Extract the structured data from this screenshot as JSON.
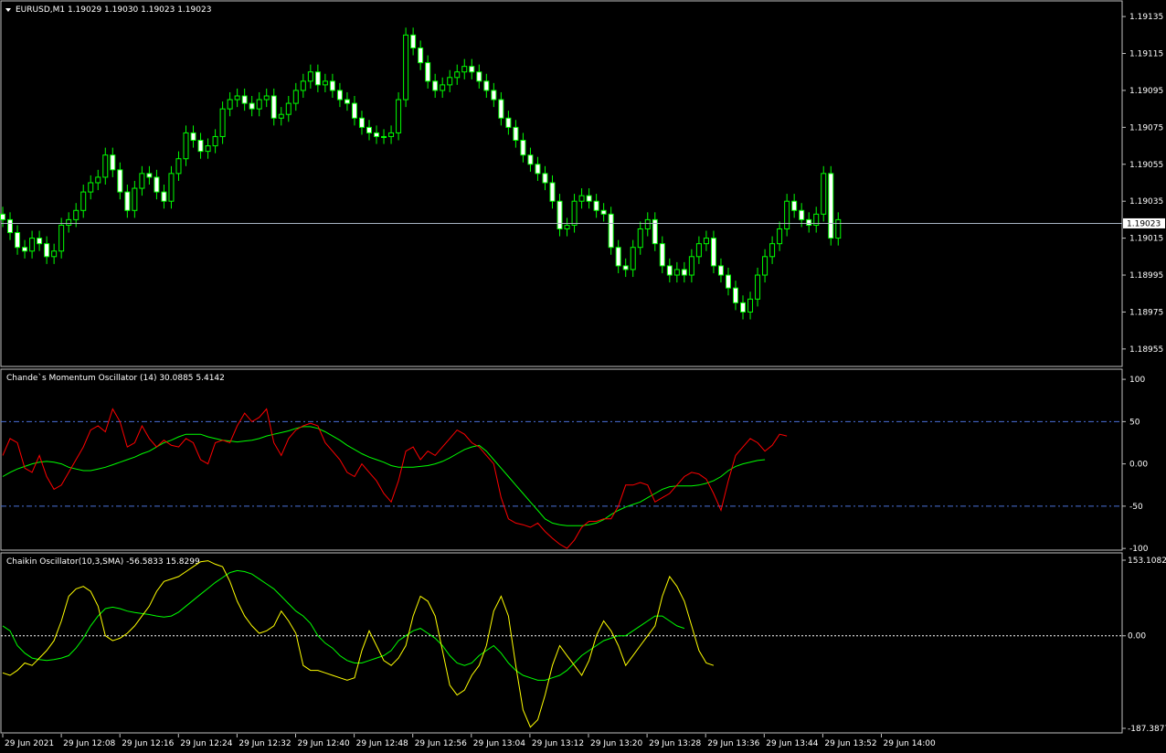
{
  "main": {
    "header": "EURUSD,M1  1.19029 1.19030 1.19023 1.19023",
    "y_ticks": [
      "1.19135",
      "1.19115",
      "1.19095",
      "1.19075",
      "1.19055",
      "1.19035",
      "1.19015",
      "1.18995",
      "1.18975",
      "1.18955"
    ],
    "y_tick_values": [
      1.19135,
      1.19115,
      1.19095,
      1.19075,
      1.19055,
      1.19035,
      1.19015,
      1.18995,
      1.18975,
      1.18955
    ],
    "price_range": [
      1.18948,
      1.1914
    ],
    "current_price": "1.19023",
    "current_price_value": 1.19023,
    "colors": {
      "candle": "#00ff00",
      "price_line": "#a8b4c4",
      "price_label_bg": "#ffffff",
      "price_label_fg": "#000000"
    },
    "chart_data": {
      "type": "candlestick",
      "bars_per_minute": 1,
      "close": [
        1.19025,
        1.19018,
        1.1901,
        1.19008,
        1.19015,
        1.19012,
        1.19005,
        1.19008,
        1.19022,
        1.19025,
        1.1903,
        1.1904,
        1.19045,
        1.19048,
        1.1906,
        1.19052,
        1.1904,
        1.1903,
        1.19042,
        1.1905,
        1.19048,
        1.1904,
        1.19035,
        1.1905,
        1.19058,
        1.19072,
        1.19068,
        1.19062,
        1.19065,
        1.1907,
        1.19085,
        1.1909,
        1.19092,
        1.19088,
        1.19085,
        1.1909,
        1.19092,
        1.1908,
        1.19082,
        1.19088,
        1.19095,
        1.191,
        1.19105,
        1.19098,
        1.191,
        1.19095,
        1.1909,
        1.19088,
        1.1908,
        1.19075,
        1.19072,
        1.1907,
        1.1907,
        1.19072,
        1.1909,
        1.19125,
        1.19118,
        1.1911,
        1.191,
        1.19095,
        1.19098,
        1.19102,
        1.19105,
        1.19108,
        1.19105,
        1.191,
        1.19095,
        1.1909,
        1.1908,
        1.19075,
        1.19068,
        1.1906,
        1.19055,
        1.1905,
        1.19045,
        1.19035,
        1.1902,
        1.19022,
        1.19035,
        1.19038,
        1.19035,
        1.1903,
        1.19028,
        1.1901,
        1.19,
        1.18998,
        1.1901,
        1.1902,
        1.19025,
        1.19012,
        1.19,
        1.18995,
        1.18998,
        1.18995,
        1.19005,
        1.19012,
        1.19015,
        1.19,
        1.18995,
        1.18988,
        1.1898,
        1.18975,
        1.18982,
        1.18995,
        1.19005,
        1.19012,
        1.1902,
        1.19035,
        1.1903,
        1.19025,
        1.19022,
        1.19028,
        1.1905,
        1.19015,
        1.19025
      ],
      "open": [
        1.19028,
        1.19025,
        1.19018,
        1.1901,
        1.19008,
        1.19015,
        1.19012,
        1.19005,
        1.19008,
        1.19022,
        1.19025,
        1.1903,
        1.1904,
        1.19045,
        1.19048,
        1.1906,
        1.19052,
        1.1904,
        1.1903,
        1.19042,
        1.1905,
        1.19048,
        1.1904,
        1.19035,
        1.1905,
        1.19058,
        1.19072,
        1.19068,
        1.19062,
        1.19065,
        1.1907,
        1.19085,
        1.1909,
        1.19092,
        1.19088,
        1.19085,
        1.1909,
        1.19092,
        1.1908,
        1.19082,
        1.19088,
        1.19095,
        1.191,
        1.19105,
        1.19098,
        1.191,
        1.19095,
        1.1909,
        1.19088,
        1.1908,
        1.19075,
        1.19072,
        1.1907,
        1.1907,
        1.19072,
        1.1909,
        1.19125,
        1.19118,
        1.1911,
        1.191,
        1.19095,
        1.19098,
        1.19102,
        1.19105,
        1.19108,
        1.19105,
        1.191,
        1.19095,
        1.1909,
        1.1908,
        1.19075,
        1.19068,
        1.1906,
        1.19055,
        1.1905,
        1.19045,
        1.19035,
        1.1902,
        1.19022,
        1.19035,
        1.19038,
        1.19035,
        1.1903,
        1.19028,
        1.1901,
        1.19,
        1.18998,
        1.1901,
        1.1902,
        1.19025,
        1.19012,
        1.19,
        1.18995,
        1.18998,
        1.18995,
        1.19005,
        1.19012,
        1.19015,
        1.19,
        1.18995,
        1.18988,
        1.1898,
        1.18975,
        1.18982,
        1.18995,
        1.19005,
        1.19012,
        1.1902,
        1.19035,
        1.1903,
        1.19025,
        1.19022,
        1.19028,
        1.1905,
        1.19015
      ]
    }
  },
  "cmo": {
    "header": "Chande`s Momentum Oscillator (14) 30.0885 5.4142",
    "y_ticks": [
      "100",
      "50",
      "0.00",
      "-50",
      "-100"
    ],
    "y_tick_values": [
      100,
      50,
      0,
      -50,
      -100
    ],
    "range": [
      -102,
      112
    ],
    "levels": [
      50,
      -50
    ],
    "colors": {
      "cmo": "#ff0000",
      "signal": "#00ff00",
      "level": "#4a6fd8"
    },
    "chart_data": {
      "type": "line",
      "series": [
        {
          "values": [
            10,
            30,
            25,
            -5,
            -10,
            10,
            -15,
            -30,
            -25,
            -10,
            5,
            20,
            40,
            45,
            38,
            65,
            50,
            20,
            25,
            45,
            30,
            20,
            28,
            22,
            20,
            30,
            25,
            5,
            0,
            25,
            28,
            25,
            45,
            60,
            50,
            55,
            65,
            25,
            10,
            30,
            40,
            45,
            48,
            45,
            25,
            15,
            5,
            -10,
            -15,
            0,
            -10,
            -20,
            -35,
            -45,
            -20,
            15,
            20,
            5,
            15,
            10,
            20,
            30,
            40,
            35,
            25,
            20,
            10,
            0,
            -40,
            -65,
            -70,
            -72,
            -75,
            -70,
            -80,
            -88,
            -95,
            -100,
            -90,
            -75,
            -68,
            -68,
            -65,
            -65,
            -50,
            -25,
            -25,
            -22,
            -25,
            -45,
            -40,
            -35,
            -25,
            -15,
            -10,
            -12,
            -18,
            -35,
            -55,
            -20,
            10,
            20,
            30,
            25,
            15,
            22,
            35,
            33
          ],
          "emphasis": "main"
        },
        {
          "values": [
            -15,
            -10,
            -6,
            -3,
            0,
            2,
            3,
            2,
            0,
            -4,
            -6,
            -8,
            -8,
            -6,
            -4,
            -1,
            2,
            5,
            8,
            12,
            15,
            20,
            25,
            28,
            32,
            35,
            35,
            35,
            32,
            30,
            28,
            27,
            26,
            27,
            28,
            30,
            33,
            35,
            37,
            39,
            42,
            44,
            44,
            42,
            38,
            33,
            28,
            22,
            17,
            12,
            8,
            5,
            2,
            -2,
            -4,
            -4,
            -4,
            -3,
            -2,
            0,
            3,
            7,
            12,
            17,
            20,
            22,
            15,
            5,
            -5,
            -15,
            -25,
            -35,
            -45,
            -55,
            -65,
            -70,
            -72,
            -73,
            -73,
            -73,
            -72,
            -70,
            -66,
            -60,
            -55,
            -51,
            -48,
            -45,
            -40,
            -35,
            -30,
            -27,
            -26,
            -26,
            -26,
            -25,
            -23,
            -20,
            -15,
            -8,
            -3,
            0,
            2,
            4,
            5
          ],
          "emphasis": "signal"
        }
      ]
    }
  },
  "chaikin": {
    "header": "Chaikin Oscillator(10,3,SMA) -56.5833 15.8299",
    "y_ticks": [
      "153.1082",
      "0.00",
      "-187.3877"
    ],
    "y_tick_values": [
      153.1082,
      0,
      -187.3877
    ],
    "range": [
      -187.3877,
      153.1082
    ],
    "zero_level": 0,
    "colors": {
      "chaikin": "#ffff00",
      "signal": "#00ff00",
      "zero": "#ffffff"
    },
    "chart_data": {
      "type": "line",
      "series": [
        {
          "values": [
            -75,
            -80,
            -70,
            -55,
            -60,
            -45,
            -30,
            -10,
            30,
            80,
            95,
            100,
            90,
            60,
            0,
            -10,
            -5,
            5,
            20,
            40,
            60,
            90,
            110,
            115,
            120,
            130,
            140,
            150,
            152,
            145,
            140,
            110,
            70,
            40,
            20,
            5,
            10,
            20,
            50,
            30,
            5,
            -60,
            -70,
            -70,
            -75,
            -80,
            -85,
            -90,
            -85,
            -30,
            10,
            -20,
            -50,
            -60,
            -45,
            -20,
            40,
            80,
            70,
            40,
            -30,
            -100,
            -120,
            -110,
            -80,
            -60,
            -20,
            50,
            80,
            40,
            -60,
            -150,
            -185,
            -170,
            -120,
            -60,
            -20,
            -40,
            -60,
            -80,
            -50,
            0,
            30,
            10,
            -20,
            -60,
            -40,
            -20,
            0,
            20,
            80,
            120,
            100,
            70,
            20,
            -30,
            -55,
            -60
          ],
          "emphasis": "main"
        },
        {
          "values": [
            20,
            10,
            -20,
            -35,
            -45,
            -48,
            -50,
            -48,
            -45,
            -40,
            -25,
            -5,
            20,
            40,
            55,
            58,
            55,
            50,
            47,
            45,
            43,
            40,
            38,
            40,
            48,
            60,
            72,
            84,
            96,
            108,
            118,
            128,
            132,
            130,
            125,
            115,
            105,
            95,
            80,
            65,
            50,
            40,
            25,
            0,
            -15,
            -25,
            -40,
            -50,
            -55,
            -55,
            -50,
            -45,
            -40,
            -30,
            -10,
            0,
            10,
            15,
            5,
            -5,
            -20,
            -40,
            -55,
            -60,
            -55,
            -40,
            -30,
            -20,
            -35,
            -55,
            -70,
            -80,
            -85,
            -90,
            -90,
            -85,
            -80,
            -70,
            -55,
            -40,
            -30,
            -20,
            -10,
            -5,
            0,
            0,
            10,
            20,
            30,
            40,
            40,
            30,
            20,
            15
          ],
          "emphasis": "signal"
        }
      ]
    }
  },
  "x_axis": {
    "labels": [
      "29 Jun 2021",
      "29 Jun 12:08",
      "29 Jun 12:16",
      "29 Jun 12:24",
      "29 Jun 12:32",
      "29 Jun 12:40",
      "29 Jun 12:48",
      "29 Jun 12:56",
      "29 Jun 13:04",
      "29 Jun 13:12",
      "29 Jun 13:20",
      "29 Jun 13:28",
      "29 Jun 13:36",
      "29 Jun 13:44",
      "29 Jun 13:52",
      "29 Jun 14:00"
    ]
  }
}
